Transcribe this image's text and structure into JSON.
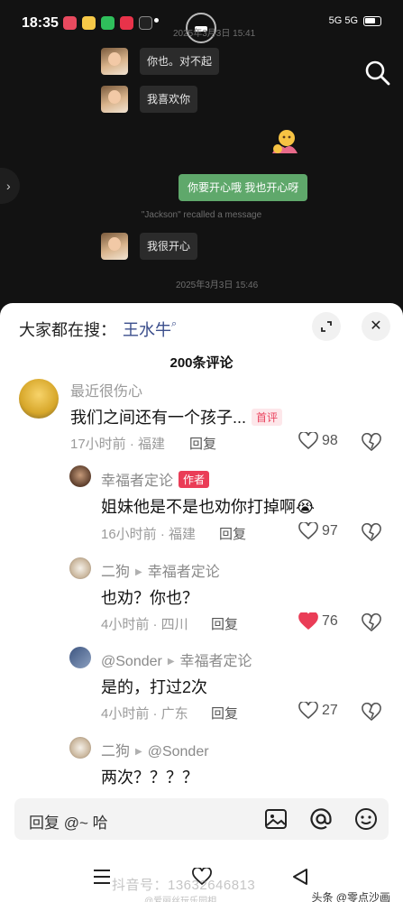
{
  "status_bar": {
    "time": "18:35",
    "right_text": "5G 5G"
  },
  "chat": {
    "timestamp_1": "2025年3月3日 15:41",
    "messages": [
      {
        "text": "你也。对不起"
      },
      {
        "text": "我喜欢你"
      },
      {
        "text": "你要开心哦 我也开心呀"
      },
      {
        "text": "我很开心"
      }
    ],
    "recall_notice": "\"Jackson\" recalled a message",
    "timestamp_2": "2025年3月3日 15:46"
  },
  "sheet": {
    "trending_label": "大家都在搜：",
    "trending_term": "王水牛",
    "comment_count": "200条评论"
  },
  "comments": [
    {
      "name": "最近很伤心",
      "text": "我们之间还有一个孩子...",
      "tag": "首评",
      "time": "17小时前 · 福建",
      "reply": "回复",
      "likes": "98"
    },
    {
      "name": "幸福者定论",
      "tag": "作者",
      "text": "姐妹他是不是也劝你打掉啊😭",
      "time": "16小时前 · 福建",
      "reply": "回复",
      "likes": "97"
    },
    {
      "name": "二狗",
      "reply_to": "幸福者定论",
      "text": "也劝？你也？",
      "time": "4小时前 · 四川",
      "reply": "回复",
      "likes": "76",
      "liked": true
    },
    {
      "name": "@Sonder",
      "reply_to": "幸福者定论",
      "text": "是的，打过2次",
      "time": "4小时前 · 广东",
      "reply": "回复",
      "likes": "27"
    },
    {
      "name": "二狗",
      "reply_to": "@Sonder",
      "text": "两次？？？？"
    }
  ],
  "input": {
    "placeholder": "回复 @~ 哈"
  },
  "watermark": {
    "text": "抖音号：13632646813",
    "sub": "@爱丽丝玩乐园相"
  },
  "toutiao": "头条 @零点沙画",
  "colors": {
    "accent_red": "#ea3d57",
    "chat_green": "#5fa86b",
    "link_blue": "#3b4e8c"
  },
  "icons": [
    "search-icon",
    "expand-icon",
    "close-icon",
    "heart-icon",
    "dislike-heart-icon",
    "image-icon",
    "at-icon",
    "emoji-icon",
    "menu-icon",
    "home-icon",
    "back-icon"
  ]
}
